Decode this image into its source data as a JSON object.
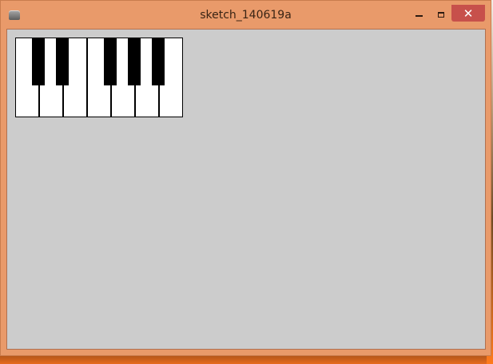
{
  "window": {
    "title": "sketch_140619a",
    "controls": {
      "minimize": "minimize-icon",
      "maximize": "maximize-icon",
      "close": "close-icon",
      "close_label": "✕"
    },
    "app_icon": "processing-app-icon"
  },
  "canvas": {
    "background": "#cccccc",
    "keyboard": {
      "white_key_count": 7,
      "black_key_count": 5,
      "white_color": "#ffffff",
      "black_color": "#000000"
    }
  },
  "colors": {
    "window_frame": "#e99a6a",
    "close_button": "#c7504b"
  }
}
